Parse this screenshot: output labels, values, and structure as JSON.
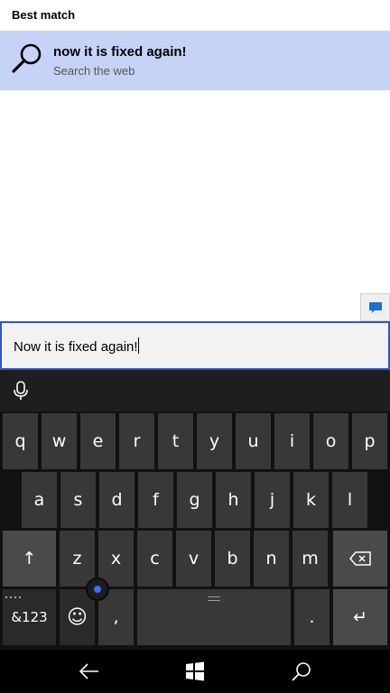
{
  "results": {
    "section_title": "Best match",
    "best_match": {
      "title": "now it is fixed again!",
      "subtitle": "Search the web",
      "icon": "search-icon"
    }
  },
  "feedback": {
    "icon": "chat-feedback-icon"
  },
  "search_box": {
    "value": "Now it is fixed again!"
  },
  "keyboard": {
    "toolbar_icon": "microphone-icon",
    "row1": [
      "q",
      "w",
      "e",
      "r",
      "t",
      "y",
      "u",
      "i",
      "o",
      "p"
    ],
    "row2": [
      "a",
      "s",
      "d",
      "f",
      "g",
      "h",
      "j",
      "k",
      "l"
    ],
    "row3": [
      "z",
      "x",
      "c",
      "v",
      "b",
      "n",
      "m"
    ],
    "shift_label": "↑",
    "backspace_icon": "backspace-icon",
    "symbols_label": "&123",
    "emoji_label": "☺",
    "comma_label": ",",
    "period_label": ".",
    "enter_label": "↵"
  },
  "navbar": {
    "back_icon": "back-arrow-icon",
    "start_icon": "windows-logo-icon",
    "search_icon": "search-icon"
  },
  "colors": {
    "accent": "#2d55d4",
    "result_highlight": "#c7d3f6",
    "keyboard_bg": "#111111",
    "key_bg": "#383838",
    "cursor_dot": "#3b6cff"
  }
}
